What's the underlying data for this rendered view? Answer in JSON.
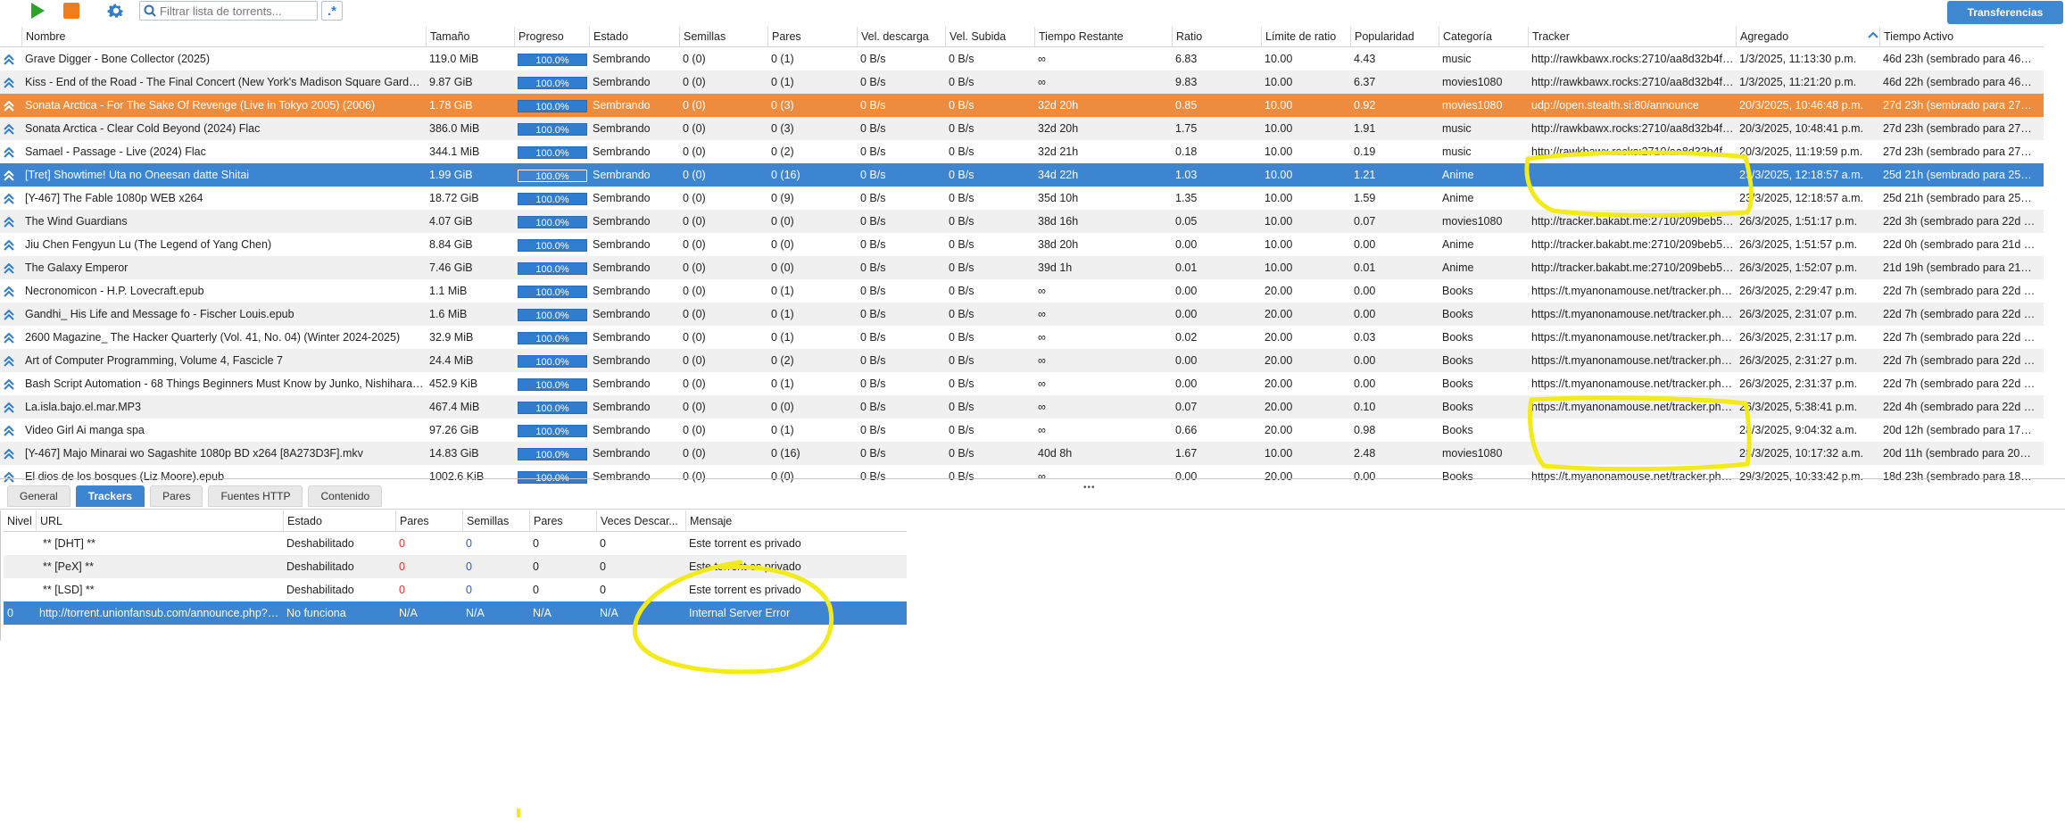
{
  "toolbar": {
    "play_icon": "play-icon",
    "stop_icon": "stop-icon",
    "settings_icon": "gear-icon",
    "search_placeholder": "Filtrar lista de torrents...",
    "regex_icon": "regex-icon",
    "transfers_label": "Transferencias"
  },
  "torrents": {
    "columns": [
      "Nombre",
      "Tamaño",
      "Progreso",
      "Estado",
      "Semillas",
      "Pares",
      "Vel. descarga",
      "Vel. Subida",
      "Tiempo Restante",
      "Ratio",
      "Límite de ratio",
      "Popularidad",
      "Categoría",
      "Tracker",
      "Agregado",
      "Tiempo Activo"
    ],
    "rows": [
      [
        "Grave Digger - Bone Collector (2025)",
        "119.0 MiB",
        "100.0%",
        "Sembrando",
        "0 (0)",
        "0 (1)",
        "0 B/s",
        "0 B/s",
        "∞",
        "6.83",
        "10.00",
        "4.43",
        "music",
        "http://rawkbawx.rocks:2710/aa8d32b4f3...",
        "1/3/2025, 11:13:30 p.m.",
        "46d 23h (sembrado para 46d ..."
      ],
      [
        "Kiss - End of the Road - The Final Concert (New York's Madison Square Garden) ...",
        "9.87 GiB",
        "100.0%",
        "Sembrando",
        "0 (0)",
        "0 (1)",
        "0 B/s",
        "0 B/s",
        "∞",
        "9.83",
        "10.00",
        "6.37",
        "movies1080",
        "http://rawkbawx.rocks:2710/aa8d32b4f3...",
        "1/3/2025, 11:21:20 p.m.",
        "46d 22h (sembrado para 46d ..."
      ],
      [
        "Sonata Arctica - For The Sake Of Revenge (Live in Tokyo 2005) (2006)",
        "1.78 GiB",
        "100.0%",
        "Sembrando",
        "0 (0)",
        "0 (3)",
        "0 B/s",
        "0 B/s",
        "32d 20h",
        "0.85",
        "10.00",
        "0.92",
        "movies1080",
        "udp://open.stealth.si:80/announce",
        "20/3/2025, 10:46:48 p.m.",
        "27d 23h (sembrado para 27d ..."
      ],
      [
        "Sonata Arctica - Clear Cold Beyond (2024) Flac",
        "386.0 MiB",
        "100.0%",
        "Sembrando",
        "0 (0)",
        "0 (3)",
        "0 B/s",
        "0 B/s",
        "32d 20h",
        "1.75",
        "10.00",
        "1.91",
        "music",
        "http://rawkbawx.rocks:2710/aa8d32b4f3...",
        "20/3/2025, 10:48:41 p.m.",
        "27d 23h (sembrado para 27d ..."
      ],
      [
        "Samael - Passage - Live (2024) Flac",
        "344.1 MiB",
        "100.0%",
        "Sembrando",
        "0 (0)",
        "0 (2)",
        "0 B/s",
        "0 B/s",
        "32d 21h",
        "0.18",
        "10.00",
        "0.19",
        "music",
        "http://rawkbawx.rocks:2710/aa8d32b4f3...",
        "20/3/2025, 11:19:59 p.m.",
        "27d 23h (sembrado para 27d ..."
      ],
      [
        "[Tret] Showtime! Uta no Oneesan datte Shitai",
        "1.99 GiB",
        "100.0%",
        "Sembrando",
        "0 (0)",
        "0 (16)",
        "0 B/s",
        "0 B/s",
        "34d 22h",
        "1.03",
        "10.00",
        "1.21",
        "Anime",
        "",
        "23/3/2025, 12:18:57 a.m.",
        "25d 21h (sembrado para 25d ..."
      ],
      [
        "[Y-467] The Fable 1080p WEB x264",
        "18.72 GiB",
        "100.0%",
        "Sembrando",
        "0 (0)",
        "0 (9)",
        "0 B/s",
        "0 B/s",
        "35d 10h",
        "1.35",
        "10.00",
        "1.59",
        "Anime",
        "",
        "23/3/2025, 12:18:57 a.m.",
        "25d 21h (sembrado para 25d ..."
      ],
      [
        "The Wind Guardians",
        "4.07 GiB",
        "100.0%",
        "Sembrando",
        "0 (0)",
        "0 (0)",
        "0 B/s",
        "0 B/s",
        "38d 16h",
        "0.05",
        "10.00",
        "0.07",
        "movies1080",
        "http://tracker.bakabt.me:2710/209beb54...",
        "26/3/2025, 1:51:17 p.m.",
        "22d 3h (sembrado para 22d 3h)"
      ],
      [
        "Jiu Chen Fengyun Lu (The Legend of Yang Chen)",
        "8.84 GiB",
        "100.0%",
        "Sembrando",
        "0 (0)",
        "0 (0)",
        "0 B/s",
        "0 B/s",
        "38d 20h",
        "0.00",
        "10.00",
        "0.00",
        "Anime",
        "http://tracker.bakabt.me:2710/209beb54...",
        "26/3/2025, 1:51:57 p.m.",
        "22d 0h (sembrado para 21d 2..."
      ],
      [
        "The Galaxy Emperor",
        "7.46 GiB",
        "100.0%",
        "Sembrando",
        "0 (0)",
        "0 (0)",
        "0 B/s",
        "0 B/s",
        "39d 1h",
        "0.01",
        "10.00",
        "0.01",
        "Anime",
        "http://tracker.bakabt.me:2710/209beb54...",
        "26/3/2025, 1:52:07 p.m.",
        "21d 19h (sembrado para 21d ..."
      ],
      [
        "Necronomicon - H.P. Lovecraft.epub",
        "1.1 MiB",
        "100.0%",
        "Sembrando",
        "0 (0)",
        "0 (1)",
        "0 B/s",
        "0 B/s",
        "∞",
        "0.00",
        "20.00",
        "0.00",
        "Books",
        "https://t.myanonamouse.net/tracker.php/...",
        "26/3/2025, 2:29:47 p.m.",
        "22d 7h (sembrado para 22d 7h)"
      ],
      [
        "Gandhi_ His Life and Message fo - Fischer Louis.epub",
        "1.6 MiB",
        "100.0%",
        "Sembrando",
        "0 (0)",
        "0 (1)",
        "0 B/s",
        "0 B/s",
        "∞",
        "0.00",
        "20.00",
        "0.00",
        "Books",
        "https://t.myanonamouse.net/tracker.php/...",
        "26/3/2025, 2:31:07 p.m.",
        "22d 7h (sembrado para 22d 7h)"
      ],
      [
        "2600 Magazine_ The Hacker Quarterly (Vol. 41, No. 04) (Winter 2024-2025)",
        "32.9 MiB",
        "100.0%",
        "Sembrando",
        "0 (0)",
        "0 (1)",
        "0 B/s",
        "0 B/s",
        "∞",
        "0.02",
        "20.00",
        "0.03",
        "Books",
        "https://t.myanonamouse.net/tracker.php/...",
        "26/3/2025, 2:31:17 p.m.",
        "22d 7h (sembrado para 22d 7h)"
      ],
      [
        "Art of Computer Programming, Volume 4, Fascicle 7",
        "24.4 MiB",
        "100.0%",
        "Sembrando",
        "0 (0)",
        "0 (2)",
        "0 B/s",
        "0 B/s",
        "∞",
        "0.00",
        "20.00",
        "0.00",
        "Books",
        "https://t.myanonamouse.net/tracker.php/...",
        "26/3/2025, 2:31:27 p.m.",
        "22d 7h (sembrado para 22d 7h)"
      ],
      [
        "Bash Script Automation - 68 Things Beginners Must Know by Junko, Nishihara Ry...",
        "452.9 KiB",
        "100.0%",
        "Sembrando",
        "0 (0)",
        "0 (1)",
        "0 B/s",
        "0 B/s",
        "∞",
        "0.00",
        "20.00",
        "0.00",
        "Books",
        "https://t.myanonamouse.net/tracker.php/...",
        "26/3/2025, 2:31:37 p.m.",
        "22d 7h (sembrado para 22d 7h)"
      ],
      [
        "La.isla.bajo.el.mar.MP3",
        "467.4 MiB",
        "100.0%",
        "Sembrando",
        "0 (0)",
        "0 (0)",
        "0 B/s",
        "0 B/s",
        "∞",
        "0.07",
        "20.00",
        "0.10",
        "Books",
        "https://t.myanonamouse.net/tracker.php/...",
        "26/3/2025, 5:38:41 p.m.",
        "22d 4h (sembrado para 22d 4h)"
      ],
      [
        "Video Girl Ai manga spa",
        "97.26 GiB",
        "100.0%",
        "Sembrando",
        "0 (0)",
        "0 (1)",
        "0 B/s",
        "0 B/s",
        "∞",
        "0.66",
        "20.00",
        "0.98",
        "Books",
        "",
        "28/3/2025, 9:04:32 a.m.",
        "20d 12h (sembrado para 17d ..."
      ],
      [
        "[Y-467] Majo Minarai wo Sagashite 1080p BD x264 [8A273D3F].mkv",
        "14.83 GiB",
        "100.0%",
        "Sembrando",
        "0 (0)",
        "0 (16)",
        "0 B/s",
        "0 B/s",
        "40d 8h",
        "1.67",
        "10.00",
        "2.48",
        "movies1080",
        "",
        "28/3/2025, 10:17:32 a.m.",
        "20d 11h (sembrado para 20d ..."
      ],
      [
        "El dios de los bosques (Liz Moore).epub",
        "1002.6 KiB",
        "100.0%",
        "Sembrando",
        "0 (0)",
        "0 (0)",
        "0 B/s",
        "0 B/s",
        "∞",
        "0.00",
        "20.00",
        "0.00",
        "Books",
        "https://t.myanonamouse.net/tracker.php/...",
        "29/3/2025, 10:33:42 p.m.",
        "18d 23h (sembrado para 18d ..."
      ]
    ]
  },
  "detail_tabs": [
    "General",
    "Trackers",
    "Pares",
    "Fuentes HTTP",
    "Contenido"
  ],
  "trackers": {
    "columns": [
      "Nivel",
      "URL",
      "Estado",
      "Pares",
      "Semillas",
      "Pares",
      "Veces Descar...",
      "Mensaje"
    ],
    "rows": [
      [
        "",
        "** [DHT] **",
        "Deshabilitado",
        "0",
        "0",
        "0",
        "0",
        "Este torrent es privado"
      ],
      [
        "",
        "** [PeX] **",
        "Deshabilitado",
        "0",
        "0",
        "0",
        "0",
        "Este torrent es privado"
      ],
      [
        "",
        "** [LSD] **",
        "Deshabilitado",
        "0",
        "0",
        "0",
        "0",
        "Este torrent es privado"
      ],
      [
        "0",
        "http://torrent.unionfansub.com/announce.php?pa...",
        "No funciona",
        "N/A",
        "N/A",
        "N/A",
        "N/A",
        "Internal Server Error"
      ]
    ]
  },
  "colors": {
    "accent": "#3d85d0",
    "orange_row": "#ed8c3e",
    "highlight": "#f2ea19",
    "play": "#2aa52a",
    "stop": "#ee7d1d"
  }
}
